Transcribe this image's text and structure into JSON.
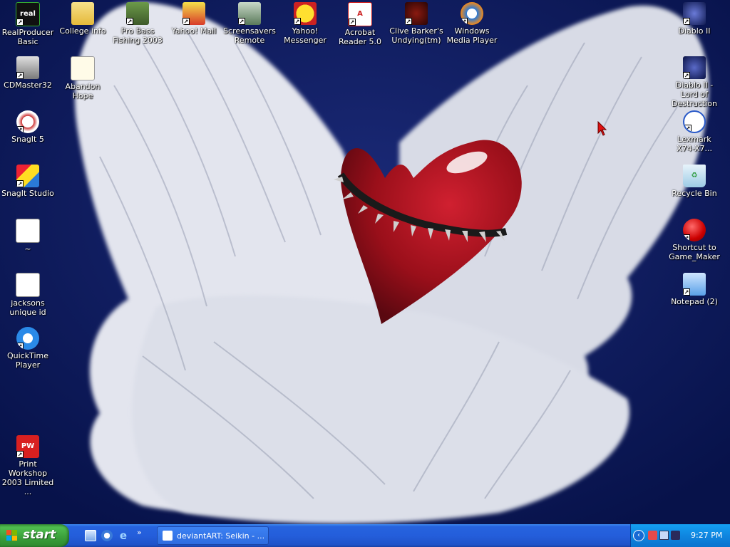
{
  "desktop": {
    "icons": [
      {
        "label": "RealProducer Basic",
        "icon": "realproducer-icon"
      },
      {
        "label": "College info",
        "icon": "folder-icon"
      },
      {
        "label": "Pro Bass Fishing 2003",
        "icon": "bass-fish-icon"
      },
      {
        "label": "Yahoo! Mail",
        "icon": "yahoo-mail-icon"
      },
      {
        "label": "Screensavers Remote",
        "icon": "screensaver-remote-icon"
      },
      {
        "label": "Yahoo! Messenger",
        "icon": "yahoo-messenger-icon"
      },
      {
        "label": "Acrobat Reader 5.0",
        "icon": "acrobat-icon"
      },
      {
        "label": "Clive Barker's Undying(tm)",
        "icon": "undying-icon"
      },
      {
        "label": "Windows Media Player",
        "icon": "media-player-icon"
      },
      {
        "label": "Diablo II",
        "icon": "diablo-icon"
      },
      {
        "label": "CDMaster32",
        "icon": "cdmaster-icon"
      },
      {
        "label": "Abandon Hope",
        "icon": "notepad-doc-icon"
      },
      {
        "label": "Diablo II - Lord of Destruction",
        "icon": "diablo-lod-icon"
      },
      {
        "label": "SnagIt 5",
        "icon": "snagit-icon"
      },
      {
        "label": "Lexmark X74-X7...",
        "icon": "lexmark-icon"
      },
      {
        "label": "SnagIt Studio",
        "icon": "snagit-studio-icon"
      },
      {
        "label": "Recycle Bin",
        "icon": "recycle-bin-icon"
      },
      {
        "label": "~",
        "icon": "window-file-icon"
      },
      {
        "label": "Shortcut to Game_Maker",
        "icon": "game-maker-icon"
      },
      {
        "label": "jacksons unique id",
        "icon": "text-file-icon"
      },
      {
        "label": "Notepad (2)",
        "icon": "notepad-icon"
      },
      {
        "label": "QuickTime Player",
        "icon": "quicktime-icon"
      },
      {
        "label": "Print Workshop 2003 Limited ...",
        "icon": "print-workshop-icon"
      }
    ]
  },
  "taskbar": {
    "start_label": "start",
    "quick_launch": [
      "show-desktop-icon",
      "media-icon",
      "internet-explorer-icon"
    ],
    "quick_launch_more": "»",
    "task_button_label": "deviantART: Seikin - ...",
    "tray_expand": "‹",
    "clock": "9:27 PM"
  },
  "colors": {
    "desktop_bg": "#0b1a5e",
    "taskbar": "#245edb",
    "start_green": "#3a9e3a",
    "tray": "#0f86e0"
  }
}
